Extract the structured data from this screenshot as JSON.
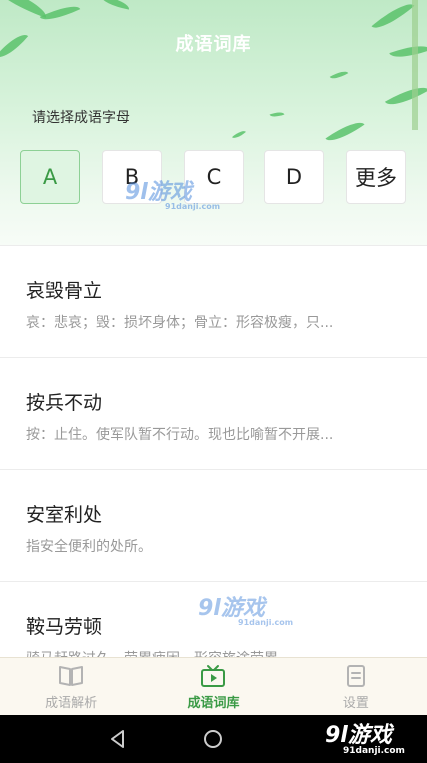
{
  "app": {
    "title": "成语词库"
  },
  "selector": {
    "prompt": "请选择成语字母",
    "letters": [
      "A",
      "B",
      "C",
      "D",
      "更多"
    ],
    "selected": "A"
  },
  "idioms": [
    {
      "title": "哀毁骨立",
      "desc": "哀：悲哀；毁：损坏身体；骨立：形容极瘦，只..."
    },
    {
      "title": "按兵不动",
      "desc": "按：止住。使军队暂不行动。现也比喻暂不开展..."
    },
    {
      "title": "安室利处",
      "desc": "指安全便利的处所。"
    },
    {
      "title": "鞍马劳顿",
      "desc": "骑马赶路过久，劳累疲困。形容旅途劳累。"
    }
  ],
  "tabs": [
    {
      "label": "成语解析",
      "icon": "book-icon",
      "active": false
    },
    {
      "label": "成语词库",
      "icon": "tv-icon",
      "active": true
    },
    {
      "label": "设置",
      "icon": "document-icon",
      "active": false
    }
  ],
  "watermark": {
    "text": "游戏",
    "domain": "91danji.com"
  },
  "colors": {
    "accent": "#3a9a45",
    "header_bg": "#d8f3dc",
    "tabbar_bg": "#fbf8f0"
  }
}
